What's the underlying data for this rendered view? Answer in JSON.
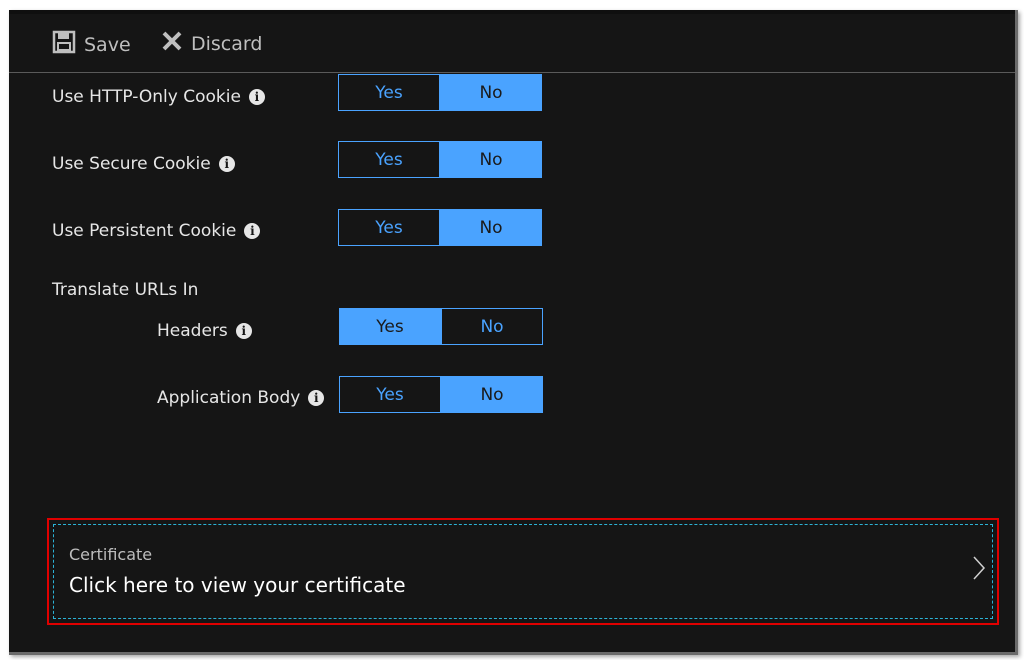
{
  "toolbar": {
    "save_label": "Save",
    "discard_label": "Discard",
    "save_icon": "save-icon",
    "discard_icon": "close-icon"
  },
  "settings": {
    "http_only_cookie": {
      "label": "Use HTTP-Only Cookie",
      "yes": "Yes",
      "no": "No",
      "selected": "No"
    },
    "secure_cookie": {
      "label": "Use Secure Cookie",
      "yes": "Yes",
      "no": "No",
      "selected": "No"
    },
    "persistent_cookie": {
      "label": "Use Persistent Cookie",
      "yes": "Yes",
      "no": "No",
      "selected": "No"
    },
    "translate_urls": {
      "label": "Translate URLs In",
      "headers": {
        "label": "Headers",
        "yes": "Yes",
        "no": "No",
        "selected": "Yes"
      },
      "application_body": {
        "label": "Application Body",
        "yes": "Yes",
        "no": "No",
        "selected": "No"
      }
    }
  },
  "certificate": {
    "title": "Certificate",
    "value": "Click here to view your certificate"
  },
  "colors": {
    "accent": "#4aa3ff",
    "background": "#151515",
    "highlight_border": "#e00000",
    "focus_border": "#2bb3d6"
  }
}
